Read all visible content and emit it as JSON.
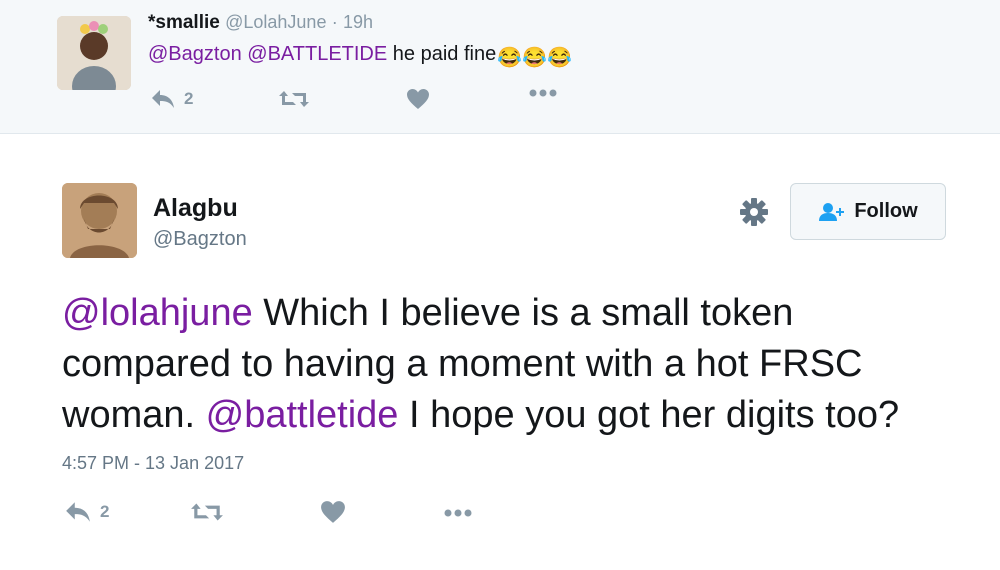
{
  "reply": {
    "name": "*smallie",
    "handle": "@LolahJune",
    "separator": "·",
    "time": "19h",
    "mention1": "@Bagzton",
    "mention2": "@BATTLETIDE",
    "text": "he paid fine",
    "emoji": "😂😂😂",
    "reply_count": "2",
    "icons": [
      "reply-icon",
      "retweet-icon",
      "heart-icon",
      "more-icon"
    ]
  },
  "tweet": {
    "name": "Alagbu",
    "handle": "@Bagzton",
    "follow_label": "Follow",
    "mention1": "@lolahjune",
    "text1": "Which I believe is a small token compared to having a moment with a hot FRSC woman.",
    "mention2": "@battletide",
    "text2": "I hope you got her digits too?",
    "timestamp": "4:57 PM - 13 Jan 2017",
    "reply_count": "2",
    "icons": [
      "gear-icon",
      "follow-user-icon",
      "reply-icon",
      "retweet-icon",
      "heart-icon",
      "more-icon"
    ]
  },
  "colors": {
    "mention": "#7a1ea1",
    "follow_icon": "#1da1f2",
    "action_icon": "#8899a6",
    "reply_background": "#f5f8fa"
  }
}
